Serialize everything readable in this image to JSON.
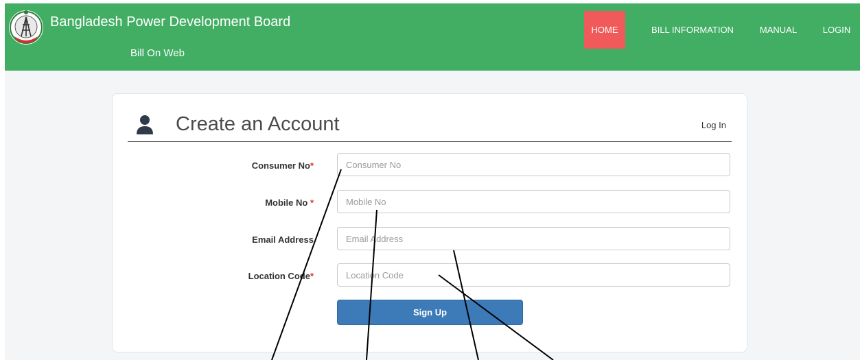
{
  "header": {
    "title": "Bangladesh Power Development Board",
    "subtitle": "Bill On Web",
    "logo_icon": "bpdb-logo-icon",
    "background_color": "#41ae63"
  },
  "nav": {
    "items": [
      {
        "label": "HOME",
        "active": true,
        "active_color": "#f05a5a"
      },
      {
        "label": "BILL INFORMATION",
        "active": false
      },
      {
        "label": "MANUAL",
        "active": false
      },
      {
        "label": "LOGIN",
        "active": false
      }
    ]
  },
  "form": {
    "icon": "user-icon",
    "title": "Create an Account",
    "login_link": "Log In",
    "fields": [
      {
        "label": "Consumer No",
        "required_mark": "*",
        "placeholder": "Consumer No",
        "value": ""
      },
      {
        "label": "Mobile No ",
        "required_mark": "*",
        "placeholder": "Mobile No",
        "value": ""
      },
      {
        "label": "Email Address",
        "required_mark": "",
        "placeholder": "Email Address",
        "value": ""
      },
      {
        "label": "Location Code",
        "required_mark": "*",
        "placeholder": "Location Code",
        "value": ""
      }
    ],
    "submit_label": "Sign Up",
    "submit_color": "#3c7ab8"
  }
}
